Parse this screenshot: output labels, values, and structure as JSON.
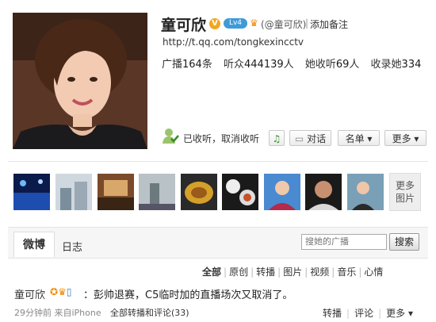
{
  "profile": {
    "name": "童可欣",
    "level_badge": "Lv4",
    "handle": "(@童可欣)",
    "add_note": "添加备注",
    "url": "http://t.qq.com/tongkexincctv",
    "stats": [
      {
        "label": "广播",
        "value": "164",
        "unit": "条"
      },
      {
        "label": "听众",
        "value": "444139",
        "unit": "人"
      },
      {
        "label": "她收听",
        "value": "69",
        "unit": "人"
      },
      {
        "label": "收录她",
        "value": "334",
        "unit": ""
      }
    ]
  },
  "actions": {
    "follow_status": "已收听，取消收听",
    "chat": "对话",
    "list": "名单 ▾",
    "more": "更多 ▾"
  },
  "photos": {
    "more_label_1": "更多",
    "more_label_2": "图片",
    "thumbs": [
      "concert",
      "city",
      "restaurant",
      "street",
      "food",
      "dishes",
      "portrait",
      "basketball",
      "office"
    ]
  },
  "tabs": {
    "weibo": "微博",
    "diary": "日志",
    "search_placeholder": "搜她的广播",
    "search_button": "搜索"
  },
  "filters": [
    "全部",
    "原创",
    "转播",
    "图片",
    "视频",
    "音乐",
    "心情"
  ],
  "feed": {
    "name": "童可欣",
    "text": "：彭帅退赛，C5临时加的直播场次又取消了。",
    "meta": "29分钟前 来自iPhone",
    "repost_comments": "全部转播和评论(33)",
    "actions": [
      "转播",
      "评论",
      "更多 ▾"
    ]
  }
}
